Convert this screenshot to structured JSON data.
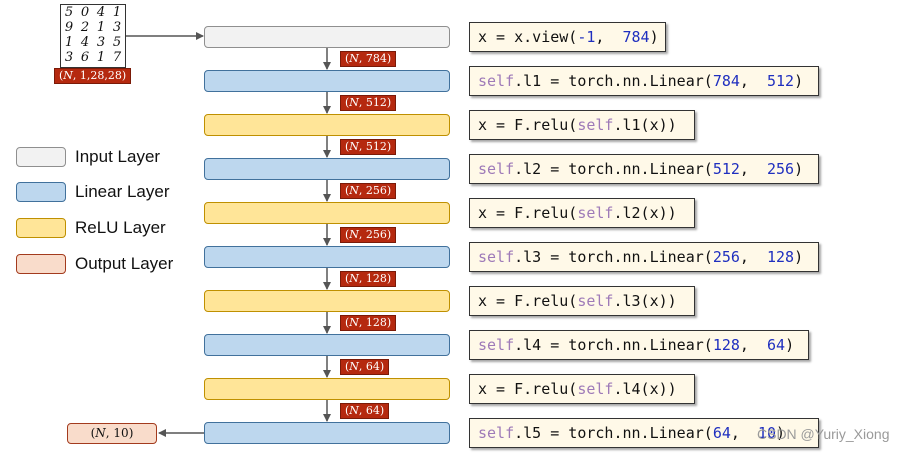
{
  "mnist_digits": [
    [
      "5",
      "0",
      "4",
      "1"
    ],
    [
      "9",
      "2",
      "1",
      "3"
    ],
    [
      "1",
      "4",
      "3",
      "5"
    ],
    [
      "3",
      "6",
      "1",
      "7"
    ]
  ],
  "input_shape": {
    "n": "N",
    "rest": ", 1,28,28)"
  },
  "layers": [
    {
      "type": "input",
      "code": [
        {
          "t": "x = x.view("
        },
        {
          "t": "-1",
          "c": "num"
        },
        {
          "t": ",  "
        },
        {
          "t": "784",
          "c": "num"
        },
        {
          "t": ")"
        }
      ]
    },
    {
      "type": "linear",
      "code": [
        {
          "t": "self",
          "c": "kw"
        },
        {
          "t": ".l1 = torch.nn.Linear("
        },
        {
          "t": "784",
          "c": "num"
        },
        {
          "t": ",  "
        },
        {
          "t": "512",
          "c": "num"
        },
        {
          "t": ")"
        }
      ]
    },
    {
      "type": "relu",
      "code": [
        {
          "t": "x = F.relu("
        },
        {
          "t": "self",
          "c": "kw"
        },
        {
          "t": ".l1(x))"
        }
      ]
    },
    {
      "type": "linear",
      "code": [
        {
          "t": "self",
          "c": "kw"
        },
        {
          "t": ".l2 = torch.nn.Linear("
        },
        {
          "t": "512",
          "c": "num"
        },
        {
          "t": ",  "
        },
        {
          "t": "256",
          "c": "num"
        },
        {
          "t": ")"
        }
      ]
    },
    {
      "type": "relu",
      "code": [
        {
          "t": "x = F.relu("
        },
        {
          "t": "self",
          "c": "kw"
        },
        {
          "t": ".l2(x))"
        }
      ]
    },
    {
      "type": "linear",
      "code": [
        {
          "t": "self",
          "c": "kw"
        },
        {
          "t": ".l3 = torch.nn.Linear("
        },
        {
          "t": "256",
          "c": "num"
        },
        {
          "t": ",  "
        },
        {
          "t": "128",
          "c": "num"
        },
        {
          "t": ")"
        }
      ]
    },
    {
      "type": "relu",
      "code": [
        {
          "t": "x = F.relu("
        },
        {
          "t": "self",
          "c": "kw"
        },
        {
          "t": ".l3(x))"
        }
      ]
    },
    {
      "type": "linear",
      "code": [
        {
          "t": "self",
          "c": "kw"
        },
        {
          "t": ".l4 = torch.nn.Linear("
        },
        {
          "t": "128",
          "c": "num"
        },
        {
          "t": ",  "
        },
        {
          "t": "64",
          "c": "num"
        },
        {
          "t": ")"
        }
      ]
    },
    {
      "type": "relu",
      "code": [
        {
          "t": "x = F.relu("
        },
        {
          "t": "self",
          "c": "kw"
        },
        {
          "t": ".l4(x))"
        }
      ]
    },
    {
      "type": "linear",
      "code": [
        {
          "t": "self",
          "c": "kw"
        },
        {
          "t": ".l5 = torch.nn.Linear("
        },
        {
          "t": "64",
          "c": "num"
        },
        {
          "t": ",  "
        },
        {
          "t": "10",
          "c": "num"
        },
        {
          "t": ")"
        }
      ]
    }
  ],
  "dims": [
    "784",
    "512",
    "512",
    "256",
    "256",
    "128",
    "128",
    "64",
    "64"
  ],
  "dim_prefix": "N",
  "legend": [
    {
      "label": "Input Layer",
      "type": "input"
    },
    {
      "label": "Linear Layer",
      "type": "linear"
    },
    {
      "label": "ReLU Layer",
      "type": "relu"
    },
    {
      "label": "Output Layer",
      "type": "output"
    }
  ],
  "output_shape": {
    "n": "N",
    "rest": ", 10)"
  },
  "watermark": "CSDN @Yuriy_Xiong",
  "colors": {
    "input": "#f2f2f2",
    "linear": "#bdd7ee",
    "relu": "#ffe598",
    "output": "#f9dccb",
    "tag": "#b5290f",
    "code_bg": "#fff9e8"
  }
}
